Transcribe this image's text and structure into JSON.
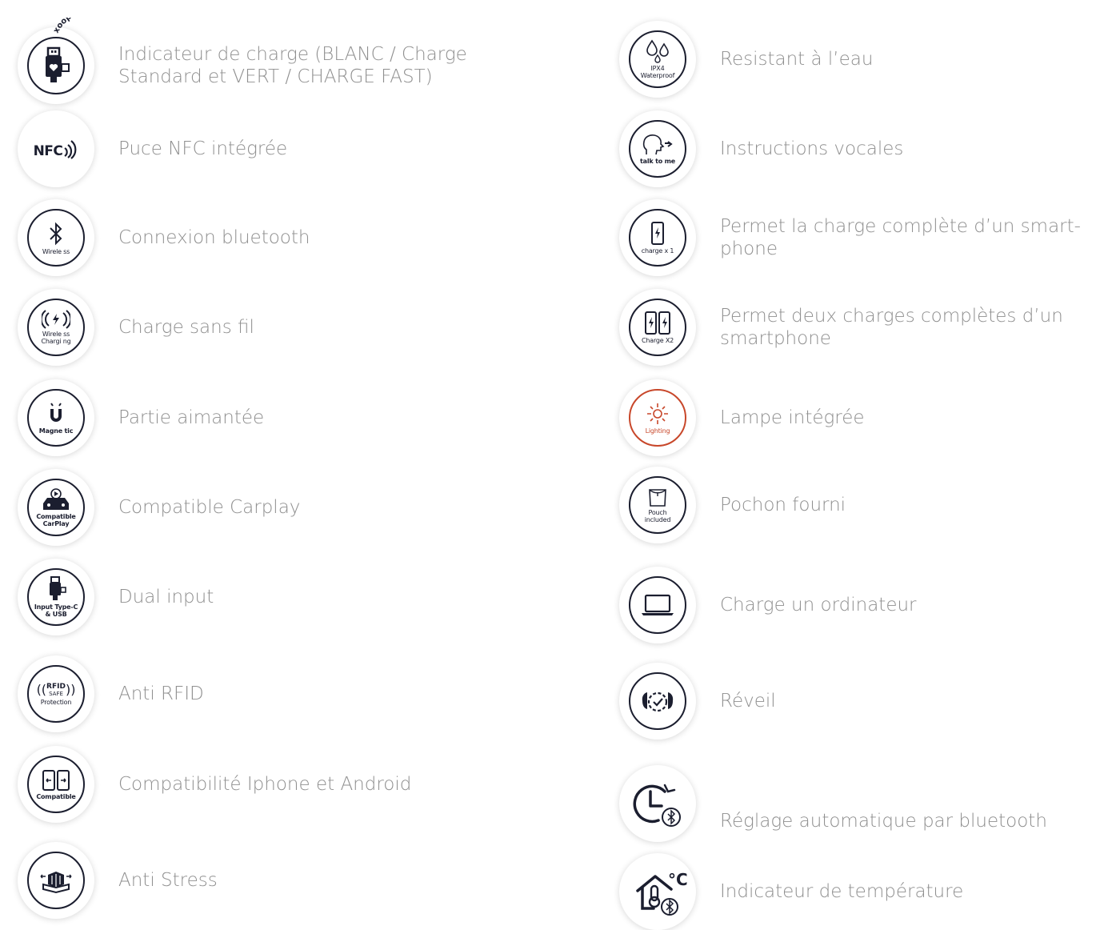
{
  "colors": {
    "text": "#8f8f8f",
    "icon": "#1b1e2f",
    "accent_orange": "#c8472a"
  },
  "brand_arc": "xoopar touch",
  "left": [
    {
      "icon": "usb-heart-icon",
      "label": "Indicateur de charge (BLANC / Charge Standard et VERT / CHARGE FAST)"
    },
    {
      "icon": "nfc-icon",
      "icon_text": "NFC",
      "label": "Puce NFC intégrée"
    },
    {
      "icon": "bluetooth-icon",
      "caption": "Wirele ss",
      "label": "Connexion bluetooth"
    },
    {
      "icon": "wireless-charging-icon",
      "caption": "Wirele ss Chargi ng",
      "label": "Charge sans fil"
    },
    {
      "icon": "magnet-icon",
      "caption": "Magne tic",
      "label": "Partie aimantée"
    },
    {
      "icon": "carplay-icon",
      "caption": "Compatible CarPlay",
      "label": "Compatible Carplay"
    },
    {
      "icon": "dual-input-icon",
      "caption": "Input Type-C & USB",
      "label": "Dual input"
    },
    {
      "icon": "rfid-icon",
      "icon_text": "RFID",
      "icon_sub": "SAFE",
      "caption": "Protection",
      "label": "Anti RFID"
    },
    {
      "icon": "phones-compatible-icon",
      "caption": "Compatible",
      "label": "Compatibilité Iphone et Android"
    },
    {
      "icon": "fidget-cube-icon",
      "label": "Anti Stress"
    }
  ],
  "right": [
    {
      "icon": "water-drops-icon",
      "caption": "IPX4 Waterproof",
      "label": "Resistant à l’eau"
    },
    {
      "icon": "talk-icon",
      "caption": "talk to me",
      "label": "Instructions vocales"
    },
    {
      "icon": "phone-charge-icon",
      "caption": "charge x 1",
      "label": "Permet la charge complète d’un smart-phone"
    },
    {
      "icon": "two-phones-charge-icon",
      "caption": "Charge X2",
      "label": "Permet deux charges complètes d’un smartphone"
    },
    {
      "icon": "light-icon",
      "caption": "Lighting",
      "label": "Lampe intégrée"
    },
    {
      "icon": "pouch-icon",
      "caption": "Pouch included",
      "label": "Pochon fourni"
    },
    {
      "icon": "laptop-icon",
      "label": "Charge un ordinateur"
    },
    {
      "icon": "alarm-clock-icon",
      "label": "Réveil"
    },
    {
      "icon": "clock-bluetooth-icon",
      "label": "Réglage automatique par bluetooth"
    },
    {
      "icon": "thermometer-house-icon",
      "icon_text": "°C",
      "label": "Indicateur de température"
    }
  ]
}
